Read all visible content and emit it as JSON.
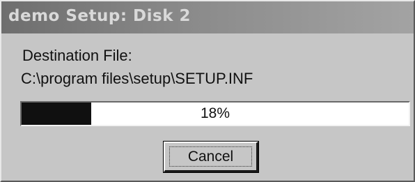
{
  "window": {
    "title": "demo Setup: Disk 2"
  },
  "content": {
    "destination_label": "Destination File:",
    "destination_path": "C:\\program files\\setup\\SETUP.INF"
  },
  "progress": {
    "percent": 18,
    "label": "18%"
  },
  "buttons": {
    "cancel_label": "Cancel"
  },
  "colors": {
    "title_bar": "#8a8a8a",
    "progress_fill": "#101010",
    "window_face": "#c6c6c6"
  }
}
